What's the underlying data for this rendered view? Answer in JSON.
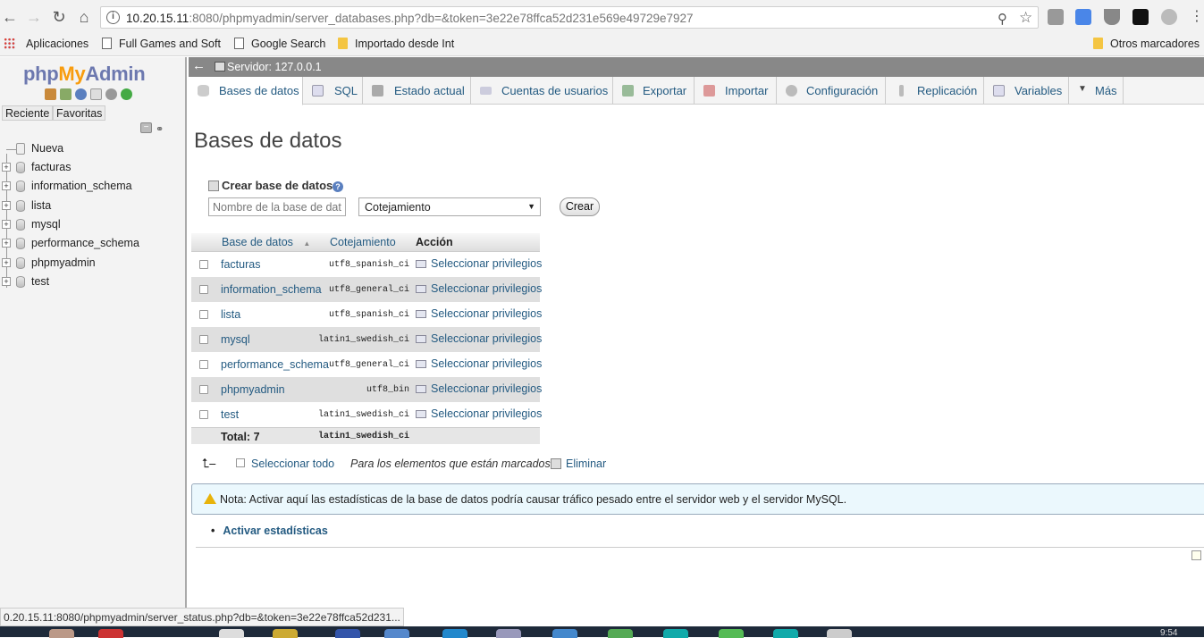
{
  "browser": {
    "url_host": "10.20.15.11",
    "url_rest": ":8080/phpmyadmin/server_databases.php?db=&token=3e22e78ffca52d231e569e49729e7927"
  },
  "bookmarks": [
    {
      "label": "Aplicaciones",
      "icon": "apps-icon"
    },
    {
      "label": "Full Games and Soft",
      "icon": "page-icon"
    },
    {
      "label": "Google Search",
      "icon": "page-icon"
    },
    {
      "label": "Importado desde Int",
      "icon": "folder-icon"
    }
  ],
  "bookmarks_other": "Otros marcadores",
  "sidebar": {
    "logo_php": "php",
    "logo_my": "My",
    "logo_admin": "Admin",
    "tab_recent": "Reciente",
    "tab_favorites": "Favoritas",
    "new_label": "Nueva",
    "databases": [
      "facturas",
      "information_schema",
      "lista",
      "mysql",
      "performance_schema",
      "phpmyadmin",
      "test"
    ]
  },
  "server_bar": {
    "label": "Servidor: 127.0.0.1"
  },
  "tabs": [
    {
      "label": "Bases de datos",
      "icon": "database-icon",
      "active": true
    },
    {
      "label": "SQL",
      "icon": "sql-icon"
    },
    {
      "label": "Estado actual",
      "icon": "status-icon"
    },
    {
      "label": "Cuentas de usuarios",
      "icon": "users-icon"
    },
    {
      "label": "Exportar",
      "icon": "export-icon"
    },
    {
      "label": "Importar",
      "icon": "import-icon"
    },
    {
      "label": "Configuración",
      "icon": "wrench-icon"
    },
    {
      "label": "Replicación",
      "icon": "replication-icon"
    },
    {
      "label": "Variables",
      "icon": "variables-icon"
    },
    {
      "label": "Más",
      "icon": "chevron-down-icon"
    }
  ],
  "main": {
    "title": "Bases de datos",
    "create_heading": "Crear base de datos",
    "name_placeholder": "Nombre de la base de datos",
    "collation_value": "Cotejamiento",
    "create_button": "Crear",
    "table": {
      "headers": [
        "Base de datos",
        "Cotejamiento",
        "Acción"
      ],
      "sort_indicator": "▲",
      "rows": [
        {
          "name": "facturas",
          "collation": "utf8_spanish_ci",
          "action": "Seleccionar privilegios"
        },
        {
          "name": "information_schema",
          "collation": "utf8_general_ci",
          "action": "Seleccionar privilegios"
        },
        {
          "name": "lista",
          "collation": "utf8_spanish_ci",
          "action": "Seleccionar privilegios"
        },
        {
          "name": "mysql",
          "collation": "latin1_swedish_ci",
          "action": "Seleccionar privilegios"
        },
        {
          "name": "performance_schema",
          "collation": "utf8_general_ci",
          "action": "Seleccionar privilegios"
        },
        {
          "name": "phpmyadmin",
          "collation": "utf8_bin",
          "action": "Seleccionar privilegios"
        },
        {
          "name": "test",
          "collation": "latin1_swedish_ci",
          "action": "Seleccionar privilegios"
        }
      ],
      "total_label": "Total: 7",
      "total_collation": "latin1_swedish_ci"
    },
    "select_all": "Seleccionar todo",
    "marked_label": "Para los elementos que están marcados:",
    "delete_label": "Eliminar",
    "notice": "Nota: Activar aquí las estadísticas de la base de datos podría causar tráfico pesado entre el servidor web y el servidor MySQL.",
    "stats_link": "Activar estadísticas"
  },
  "status_bar": "0.20.15.11:8080/phpmyadmin/server_status.php?db=&token=3e22e78ffca52d231...",
  "clock": "9:54"
}
